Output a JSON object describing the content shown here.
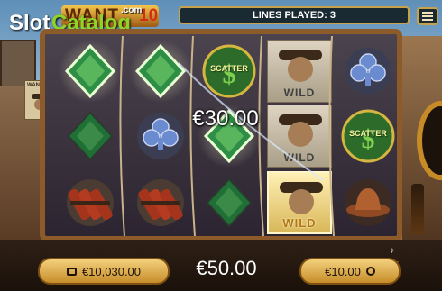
{
  "watermark": {
    "site_name_part1": "Slot",
    "site_name_part2": "Catalog",
    "site_tld": ".com"
  },
  "logo": {
    "title_partial": "WANT",
    "number": "10"
  },
  "header": {
    "lines_played": "LINES PLAYED: 3",
    "menu_icon": "menu-icon"
  },
  "win": {
    "amount": "€30.00"
  },
  "reels": [
    [
      "diamond",
      "diamond",
      "dynamite"
    ],
    [
      "diamond",
      "club",
      "dynamite"
    ],
    [
      "scatter",
      "diamond",
      "diamond"
    ],
    [
      "wild",
      "wild",
      "wild"
    ],
    [
      "club",
      "scatter",
      "cowboy-hat"
    ]
  ],
  "symbol_text": {
    "scatter": "SCATTER",
    "wild": "WILD"
  },
  "poster": {
    "label": "WANTED"
  },
  "bottom_bar": {
    "balance": "€10,030.00",
    "total": "€50.00",
    "bet": "€10.00",
    "sound_icon": "music-icon",
    "turbo_icon": "lightning-icon"
  },
  "colors": {
    "gold": "#c68d2a",
    "frame": "#8d5a2a",
    "diamond_green": "#1f7a37"
  }
}
